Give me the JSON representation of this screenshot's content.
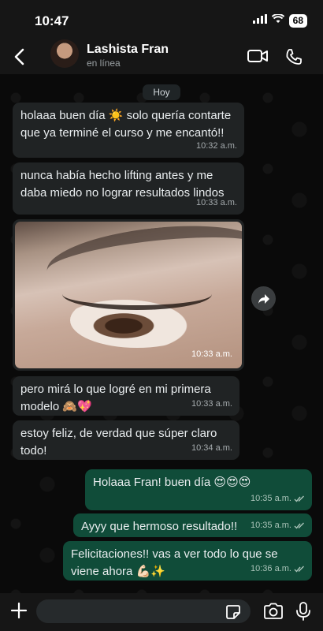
{
  "status": {
    "time": "10:47",
    "battery": "68"
  },
  "header": {
    "name": "Lashista Fran",
    "status": "en línea"
  },
  "chat": {
    "day": "Hoy"
  },
  "messages": [
    {
      "dir": "in",
      "text": "holaaa buen día ☀️ solo quería contarte que ya terminé el curso y me encantó!!",
      "time": "10:32 a.m."
    },
    {
      "dir": "in",
      "text": "nunca había hecho lifting antes y me daba miedo no lograr resultados lindos",
      "time": "10:33 a.m."
    },
    {
      "dir": "in",
      "type": "photo",
      "time": "10:33 a.m."
    },
    {
      "dir": "in",
      "text": "pero mirá lo que logré en mi primera modelo 🙈💖",
      "time": "10:33 a.m."
    },
    {
      "dir": "in",
      "text": "estoy feliz, de verdad que súper claro todo!",
      "time": "10:34 a.m."
    },
    {
      "dir": "out",
      "text": "Holaaa Fran! buen día 😍😍😍",
      "time": "10:35 a.m."
    },
    {
      "dir": "out",
      "text": "Ayyy que hermoso resultado!!",
      "time": "10:35 a.m."
    },
    {
      "dir": "out",
      "text": "Felicitaciones!! vas a ver todo lo que se viene ahora 💪🏻✨",
      "time": "10:36 a.m."
    }
  ],
  "input": {
    "value": "",
    "placeholder": ""
  },
  "icons": {
    "back": "chevron-left-icon",
    "video": "video-camera-icon",
    "call": "phone-icon",
    "forward": "forward-arrow-icon",
    "plus": "plus-icon",
    "sticker": "sticker-icon",
    "camera": "camera-icon",
    "mic": "microphone-icon",
    "read": "double-check-icon"
  },
  "colors": {
    "incoming": "#202324",
    "outgoing": "#104c39",
    "background": "#0a0a0a"
  }
}
